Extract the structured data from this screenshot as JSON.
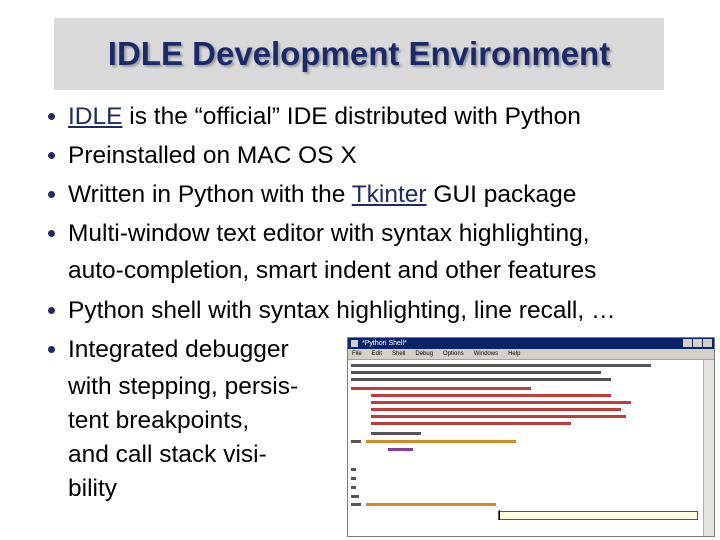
{
  "title": "IDLE Development Environment",
  "bullets": [
    {
      "link": "IDLE",
      "text": " is the “official” IDE distributed with Python"
    },
    {
      "text": "Preinstalled on MAC OS X"
    },
    {
      "pre": "Written in Python with the ",
      "link": "Tkinter",
      "post": " GUI package"
    },
    {
      "text": "Multi-window text editor with syntax highlighting,",
      "cont": [
        "auto-completion, smart indent and other features"
      ]
    },
    {
      "text": "Python shell with syntax highlighting, line recall, …"
    },
    {
      "text": "Integrated debugger",
      "cont": [
        "with stepping, persis-",
        "tent breakpoints,",
        "and call stack visi-",
        "bility"
      ]
    }
  ],
  "screenshot": {
    "window_title": "*Python Shell*",
    "menu": [
      "File",
      "Edit",
      "Shell",
      "Debug",
      "Options",
      "Windows",
      "Help"
    ]
  }
}
